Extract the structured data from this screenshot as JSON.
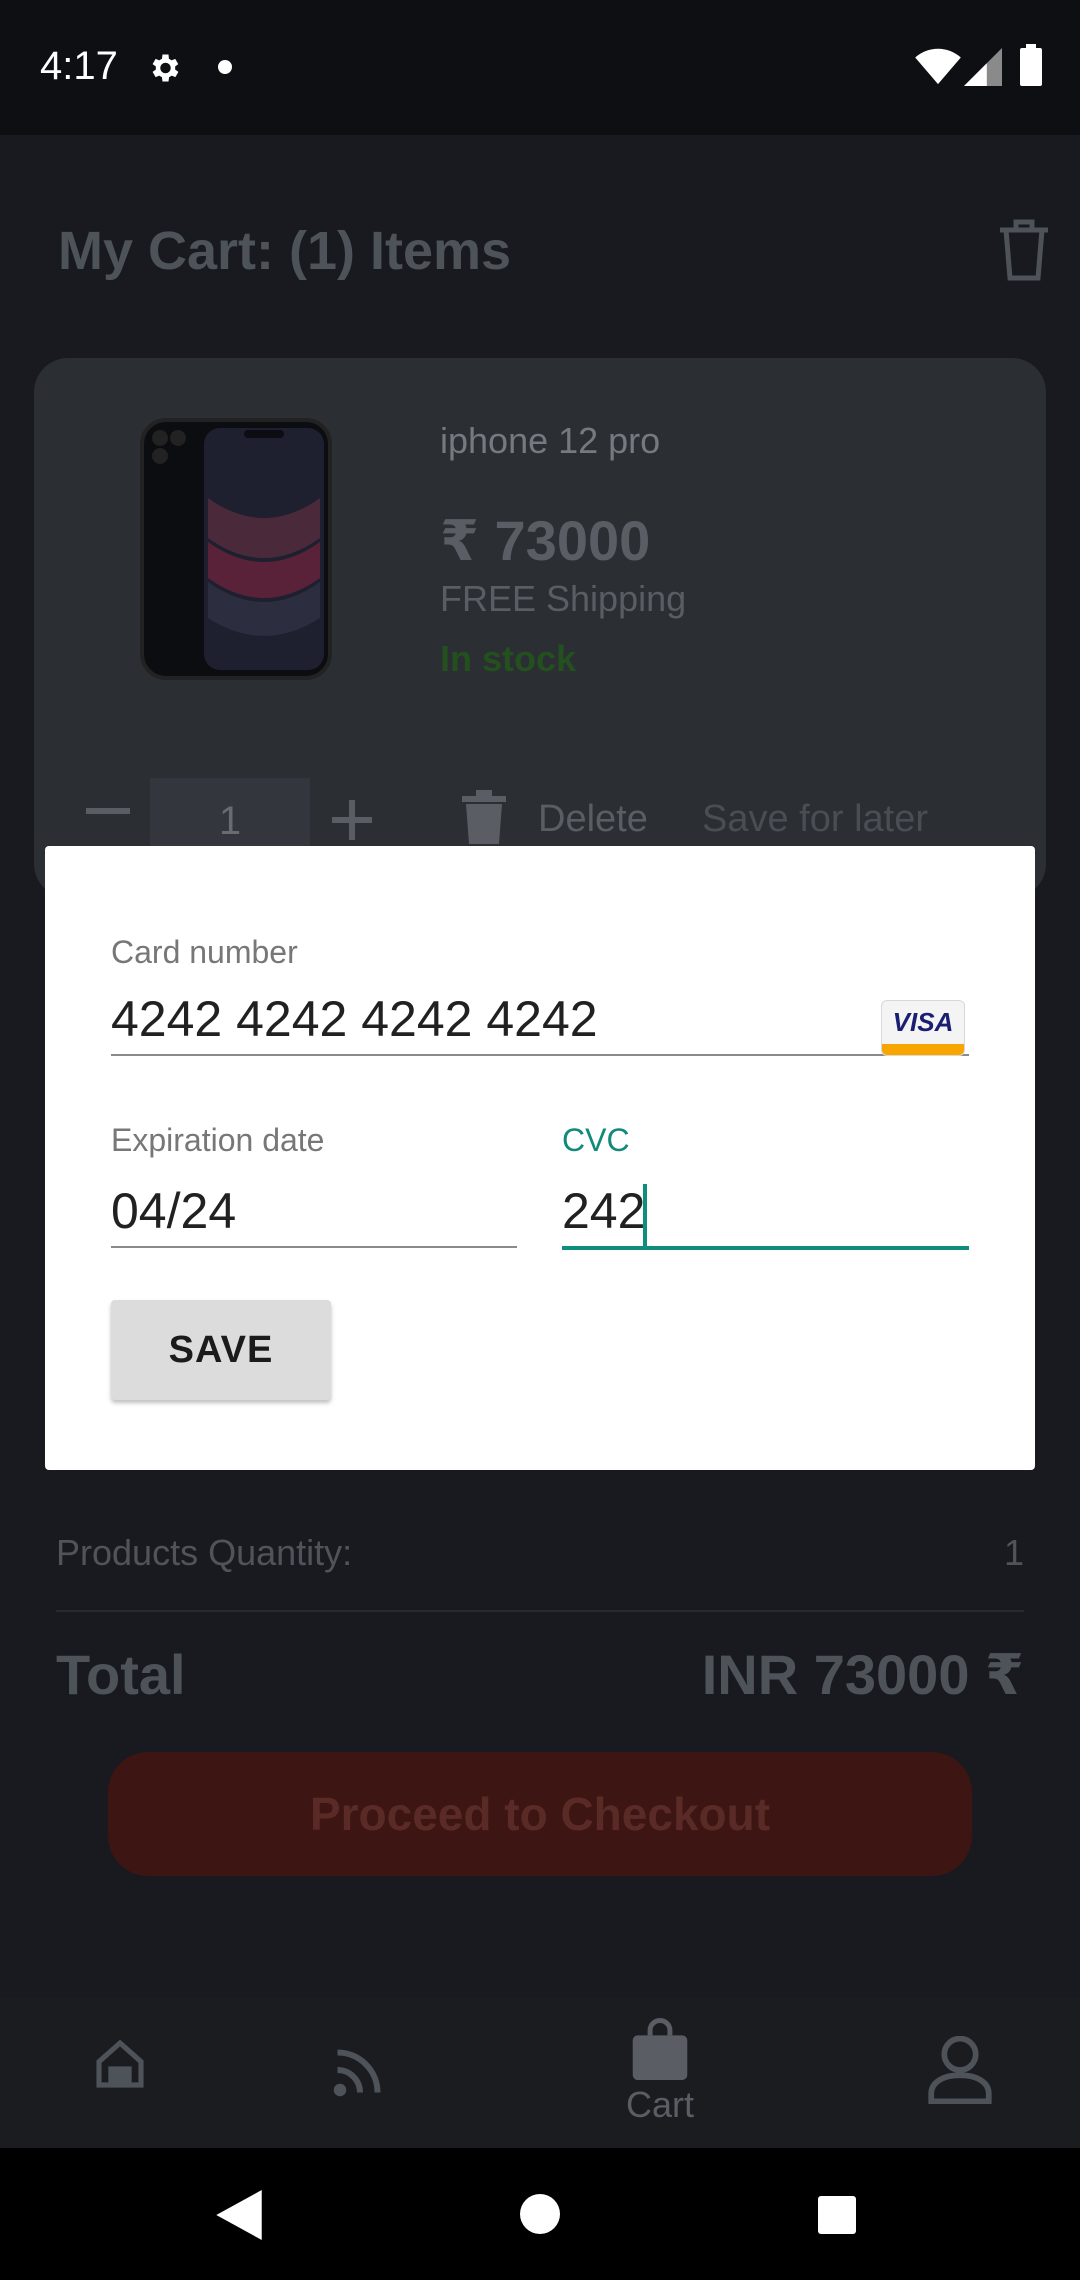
{
  "status_bar": {
    "time": "4:17"
  },
  "cart": {
    "title": "My Cart: (1) Items",
    "item": {
      "name": "iphone 12 pro",
      "price": "₹ 73000",
      "shipping": "FREE Shipping",
      "stock": "In stock",
      "quantity": "1",
      "delete_label": "Delete",
      "save_later_label": "Save for later"
    },
    "summary": {
      "quantity_label": "Products Quantity:",
      "quantity_value": "1",
      "total_label": "Total",
      "total_value": "INR 73000 ₹"
    },
    "checkout_label": "Proceed to Checkout"
  },
  "bottom_nav": {
    "items": [
      {
        "icon": "home-icon"
      },
      {
        "icon": "feed-icon"
      },
      {
        "icon": "cart-bag-icon",
        "label": "Cart"
      },
      {
        "icon": "profile-icon"
      }
    ]
  },
  "dialog": {
    "card_number_label": "Card number",
    "card_number_value": "4242 4242 4242 4242",
    "card_brand": "VISA",
    "expiration_label": "Expiration date",
    "expiration_value": "04/24",
    "cvc_label": "CVC",
    "cvc_value": "242",
    "save_label": "SAVE"
  },
  "colors": {
    "accent": "#0f8e7e",
    "checkout_dimmed": "#3d1512",
    "stock_dimmed": "#24501f"
  }
}
